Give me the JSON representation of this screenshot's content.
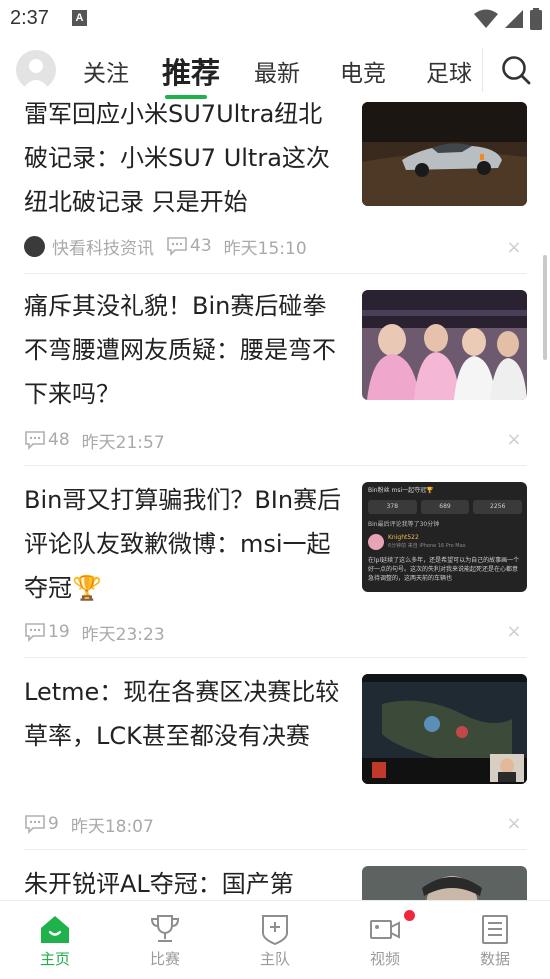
{
  "status_bar": {
    "time": "2:37",
    "notification_icon": "A",
    "icons": [
      "wifi-icon",
      "signal-icon",
      "battery-icon"
    ]
  },
  "header": {
    "tabs": [
      {
        "label": "关注",
        "active": false
      },
      {
        "label": "推荐",
        "active": true
      },
      {
        "label": "最新",
        "active": false
      },
      {
        "label": "电竞",
        "active": false
      },
      {
        "label": "足球",
        "active": false
      }
    ],
    "accent_color": "#1fb14a"
  },
  "feed": {
    "articles": [
      {
        "title": "雷军回应小米SU7Ultra纽北破记录：小米SU7 Ultra这次纽北破记录 只是开始",
        "source": "快看科技资讯",
        "comments": "43",
        "time": "昨天15:10",
        "thumbnail": "race-car-photo"
      },
      {
        "title": "痛斥其没礼貌！Bin赛后碰拳不弯腰遭网友质疑：腰是弯不下来吗？",
        "comments": "48",
        "time": "昨天21:57",
        "thumbnail": "players-handshake-photo"
      },
      {
        "title": "Bin哥又打算骗我们？BIn赛后评论队友致歉微博：msi一起夺冠🏆",
        "comments": "19",
        "time": "昨天23:23",
        "thumbnail": "weibo-post-screenshot",
        "thumb_text": {
          "header": "Bin粉丝 msi一起夺冠🏆",
          "stats": [
            "378",
            "689",
            "2256"
          ],
          "caption": "Bin最后评论我等了30分钟",
          "user": "Knight522",
          "user_meta": "6分钟前 来自 iPhone 16 Pro Max",
          "body": "在lpl延续了这么多年，还是希望可以为自己的故事画一个好一点的句号。这次的失利对我来说能起死还是在心都意急待调整的，这两天前的车辆也"
        }
      },
      {
        "title": "Letme：现在各赛区决赛比较草率，LCK甚至都没有决赛",
        "comments": "9",
        "time": "昨天18:07",
        "thumbnail": "game-stream-screenshot"
      },
      {
        "title": "朱开锐评AL夺冠：国产第",
        "thumbnail": "person-photo"
      }
    ]
  },
  "bottom_nav": {
    "items": [
      {
        "label": "主页",
        "icon": "home-icon",
        "active": true
      },
      {
        "label": "比赛",
        "icon": "trophy-icon",
        "active": false
      },
      {
        "label": "主队",
        "icon": "team-shield-icon",
        "active": false
      },
      {
        "label": "视频",
        "icon": "video-camera-icon",
        "active": false,
        "badge": true
      },
      {
        "label": "数据",
        "icon": "data-list-icon",
        "active": false
      }
    ]
  }
}
